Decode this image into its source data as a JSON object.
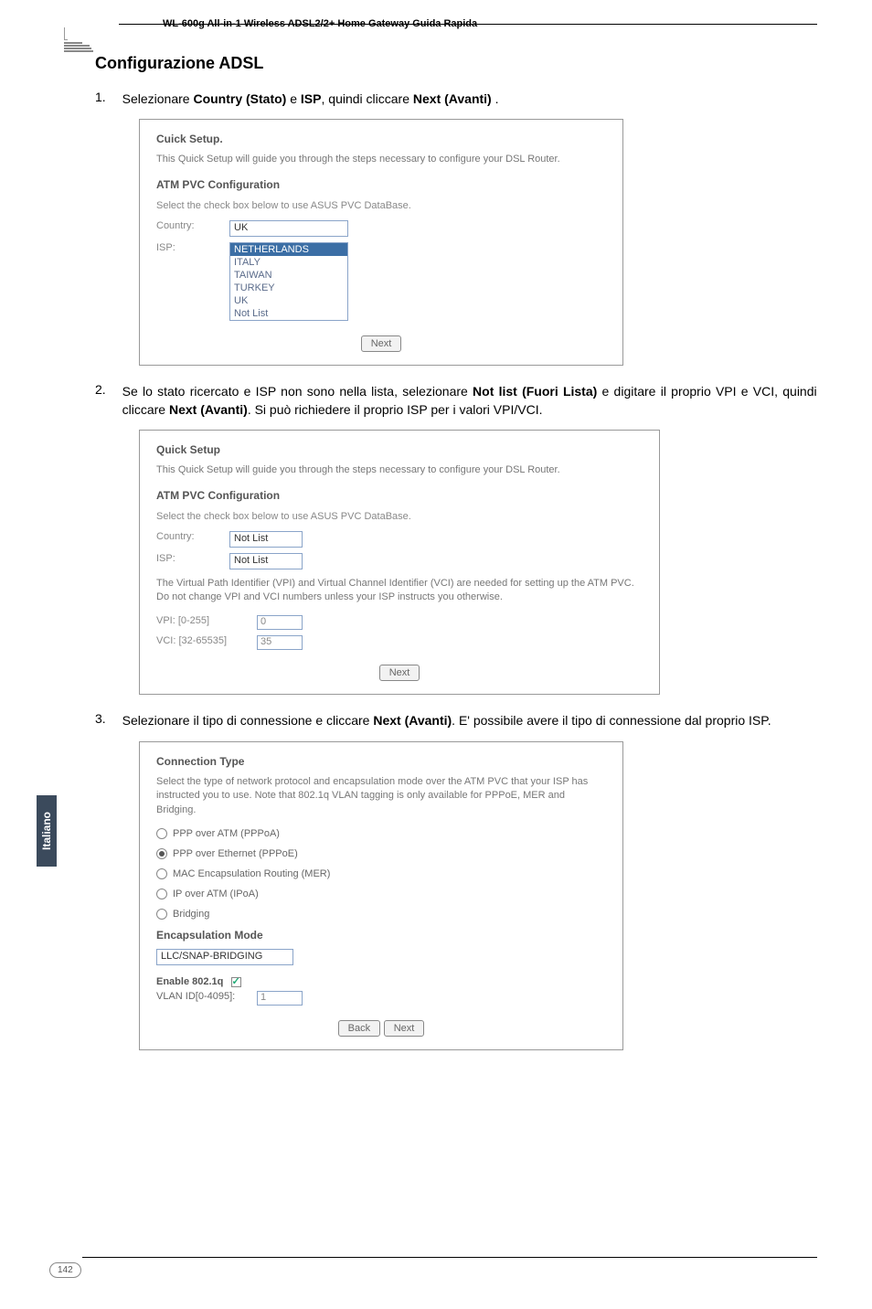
{
  "header": {
    "product": "WL-600g All-in-1 Wireless ADSL2/2+ Home Gateway Guida Rapida"
  },
  "section": {
    "title": "Configurazione ADSL"
  },
  "steps": {
    "s1": {
      "num": "1.",
      "txt_a": "Selezionare ",
      "b1": "Country (Stato)",
      "txt_b": " e ",
      "b2": "ISP",
      "txt_c": ", quindi cliccare ",
      "b3": "Next (Avanti)",
      "txt_d": " ."
    },
    "s2": {
      "num": "2.",
      "txt_a": "Se lo stato ricercato e ISP non sono nella lista, selezionare ",
      "b1": "Not list (Fuori Lista)",
      "txt_b": " e  digitare il proprio VPI e VCI, quindi cliccare ",
      "b2": "Next (Avanti)",
      "txt_c": ". Si può richiedere il proprio ISP per i valori VPI/VCI."
    },
    "s3": {
      "num": "3.",
      "txt_a": "Selezionare il tipo di connessione e cliccare ",
      "b1": "Next (Avanti)",
      "txt_b": ". E' possibile avere il tipo di connessione dal proprio ISP."
    }
  },
  "shot1": {
    "title": "Cuick Setup.",
    "desc": "This Quick Setup will guide you through the steps necessary to configure your DSL Router.",
    "sub": "ATM PVC Configuration",
    "note": "Select the check box below to use ASUS PVC DataBase.",
    "country_lbl": "Country:",
    "isp_lbl": "ISP:",
    "country_val": "UK",
    "isp_opts": [
      "NETHERLANDS",
      "ITALY",
      "TAIWAN",
      "TURKEY",
      "UK",
      "Not List"
    ],
    "next": "Next"
  },
  "shot2": {
    "title": "Quick Setup",
    "desc": "This Quick Setup will guide you through the steps necessary to configure your DSL Router.",
    "sub": "ATM PVC Configuration",
    "note": "Select the check box below to use ASUS PVC DataBase.",
    "country_lbl": "Country:",
    "isp_lbl": "ISP:",
    "country_val": "Not List",
    "isp_val": "Not List",
    "vpi_desc": "The Virtual Path Identifier (VPI) and Virtual Channel Identifier (VCI) are needed for setting up the ATM PVC. Do not change VPI and VCI numbers unless your ISP instructs you otherwise.",
    "vpi_lbl": "VPI: [0-255]",
    "vci_lbl": "VCI: [32-65535]",
    "vpi_val": "0",
    "vci_val": "35",
    "next": "Next"
  },
  "shot3": {
    "title": "Connection Type",
    "desc": "Select the type of network protocol and encapsulation mode over the ATM PVC that your ISP has instructed you to use. Note that 802.1q VLAN tagging is only available for PPPoE, MER and Bridging.",
    "opt1": "PPP over ATM (PPPoA)",
    "opt2": "PPP over Ethernet (PPPoE)",
    "opt3": "MAC Encapsulation Routing (MER)",
    "opt4": "IP over ATM (IPoA)",
    "opt5": "Bridging",
    "enc_lbl": "Encapsulation Mode",
    "enc_val": "LLC/SNAP-BRIDGING",
    "q_lbl": "Enable 802.1q",
    "vlan_lbl": "VLAN ID[0-4095]:",
    "vlan_val": "1",
    "back": "Back",
    "next": "Next"
  },
  "sidebar": {
    "lang": "Italiano"
  },
  "footer": {
    "page": "142"
  }
}
